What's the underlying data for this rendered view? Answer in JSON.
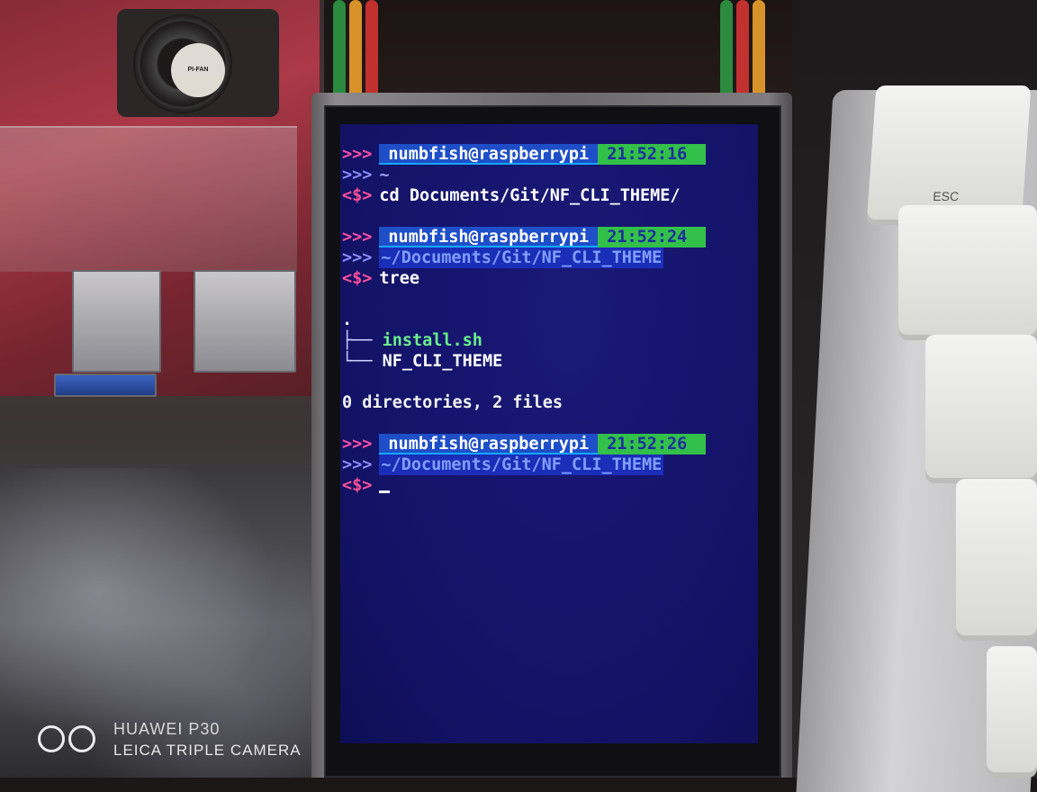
{
  "terminal": {
    "blocks": [
      {
        "marker1": ">>>",
        "user": "numbfish@raspberrypi",
        "time": "21:52:16",
        "marker2": ">>>",
        "path": "~",
        "prompt": "<$>",
        "command": "cd Documents/Git/NF_CLI_THEME/"
      },
      {
        "marker1": ">>>",
        "user": "numbfish@raspberrypi",
        "time": "21:52:24",
        "marker2": ">>>",
        "path": "~/Documents/Git/NF_CLI_THEME",
        "prompt": "<$>",
        "command": "tree"
      },
      {
        "marker1": ">>>",
        "user": "numbfish@raspberrypi",
        "time": "21:52:26",
        "marker2": ">>>",
        "path": "~/Documents/Git/NF_CLI_THEME",
        "prompt": "<$>",
        "command": "_"
      }
    ],
    "tree_output": {
      "root": ".",
      "branch1": "├──",
      "entry1": "install.sh",
      "branch2": "└──",
      "entry2": "NF_CLI_THEME",
      "summary": "0 directories, 2 files"
    },
    "colors": {
      "background": "#15156e",
      "user_badge": "#1e4fc8",
      "time_badge": "#33c04a",
      "marker": "#ff4fa5",
      "executable": "#6af08a"
    }
  },
  "background": {
    "fan_label": "PI-FAN",
    "keycap_esc": "ESC"
  },
  "watermark": {
    "line1": "HUAWEI P30",
    "line2": "LEICA TRIPLE CAMERA"
  }
}
